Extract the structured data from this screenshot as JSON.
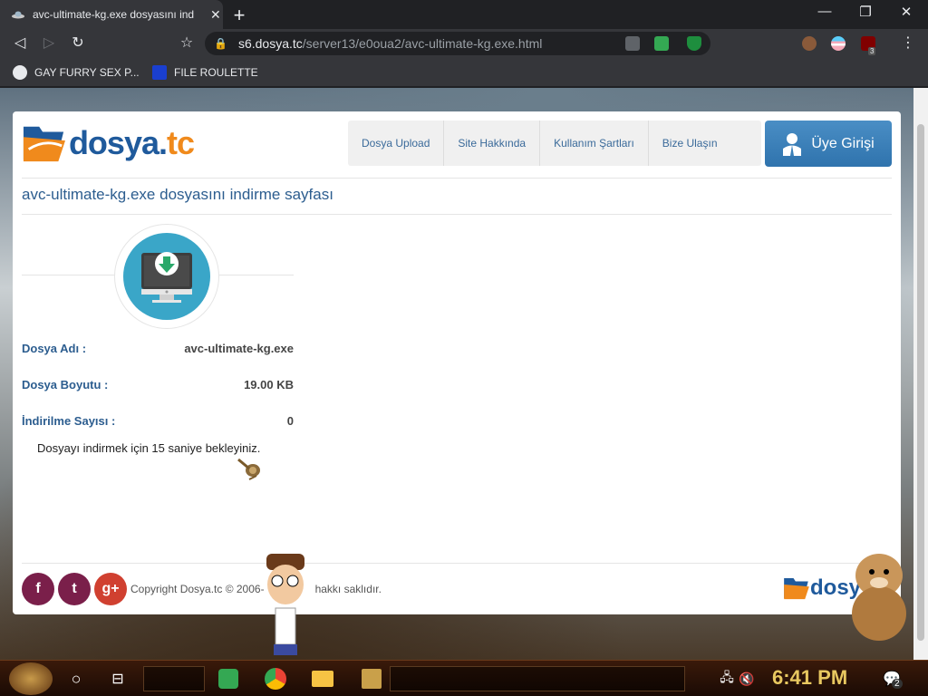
{
  "browser": {
    "tab_title": "avc-ultimate-kg.exe dosyasını ind",
    "tab_close": "✕",
    "new_tab": "+",
    "window_controls": {
      "minimize": "—",
      "maximize": "❐",
      "close": "✕"
    },
    "url_host": "s6.dosya.tc",
    "url_path": "/server13/e0oua2/avc-ultimate-kg.exe.html",
    "nav_back": "◁",
    "nav_forward": "▷",
    "nav_reload": "↻",
    "bookmark_star": "☆",
    "lock": "🔒",
    "menu": "⋮",
    "ext_badge_count": "3"
  },
  "bookmarks": [
    {
      "label": "GAY FURRY SEX P...",
      "icon": "globe-icon"
    },
    {
      "label": "FILE ROULETTE",
      "icon": "mft-icon"
    }
  ],
  "site": {
    "logo_part1": "dosya.",
    "logo_part2": "tc",
    "nav": [
      {
        "label": "Dosya Upload"
      },
      {
        "label": "Site Hakkında"
      },
      {
        "label": "Kullanım Şartları"
      },
      {
        "label": "Bize Ulaşın"
      }
    ],
    "login_label": "Üye Girişi",
    "page_heading": "avc-ultimate-kg.exe dosyasını indirme sayfası",
    "file_name_label": "Dosya Adı :",
    "file_name_value": "avc-ultimate-kg.exe",
    "file_size_label": "Dosya Boyutu :",
    "file_size_value": "19.00 KB",
    "download_count_label": "İndirilme Sayısı :",
    "download_count_value": "0",
    "wait_message": "Dosyayı indirmek için 15 saniye bekleyiniz.",
    "copyright": "Copyright Dosya.tc © 2006-",
    "copyright_tail": "hakkı saklıdır.",
    "footer_logo": "dosy",
    "social": [
      {
        "label": "f",
        "color": "#7a1f4a"
      },
      {
        "label": "t",
        "color": "#7a1f4a"
      },
      {
        "label": "g+",
        "color": "#d04030"
      }
    ],
    "brand_blue": "#1f5a9c",
    "brand_orange": "#f08a1c"
  },
  "taskbar": {
    "clock": "6:41 PM",
    "notification_count": "2"
  }
}
